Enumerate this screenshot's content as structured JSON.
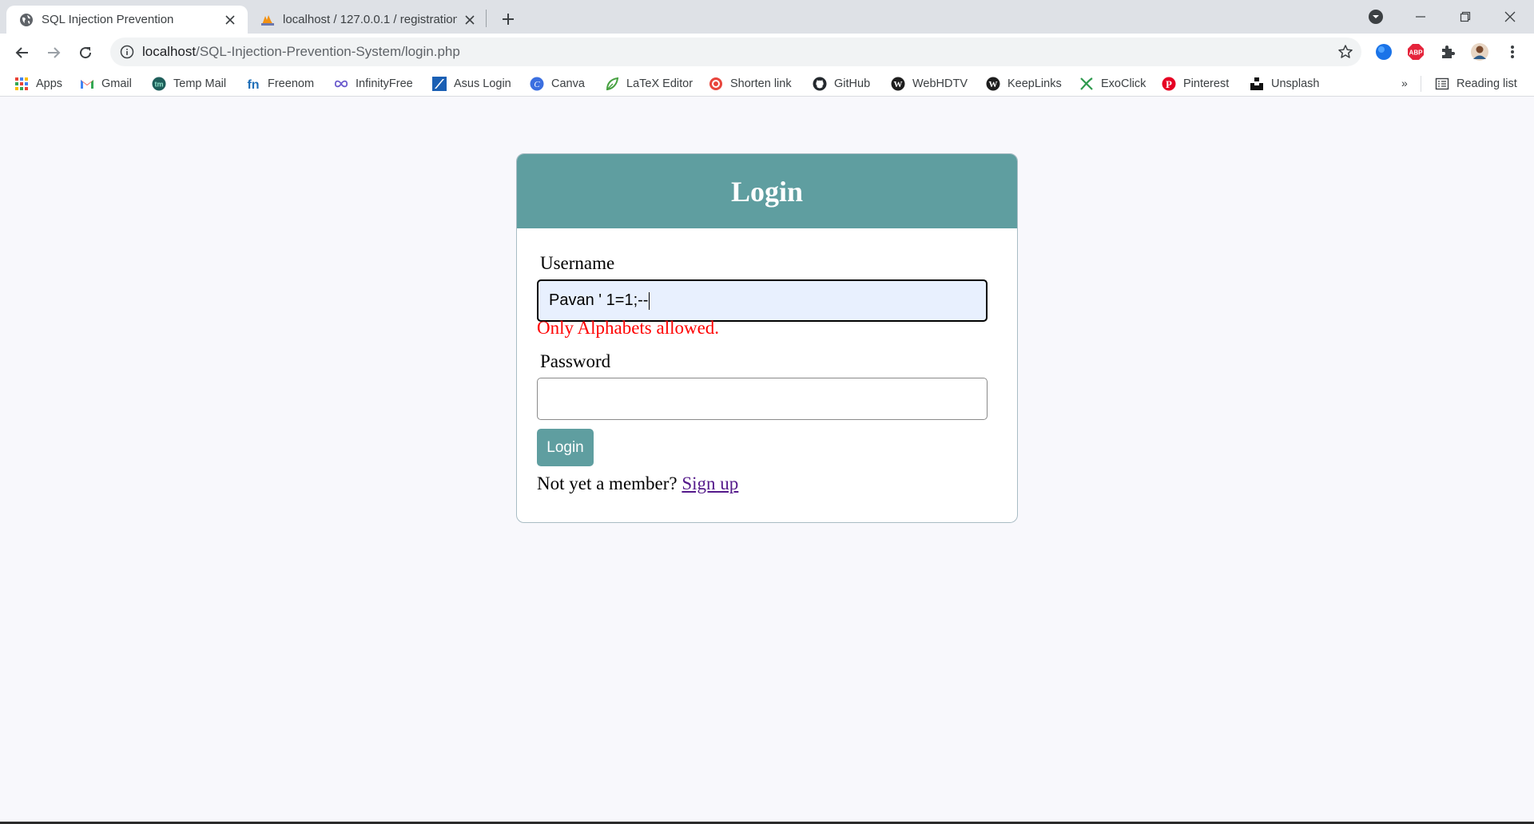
{
  "browser": {
    "tabs": [
      {
        "title": "SQL Injection Prevention",
        "active": true
      },
      {
        "title": "localhost / 127.0.0.1 / registration",
        "active": false
      }
    ],
    "address": {
      "host": "localhost",
      "path": "/SQL-Injection-Prevention-System/login.php"
    },
    "bookmarks": [
      {
        "label": "Apps",
        "icon": "apps-grid-icon"
      },
      {
        "label": "Gmail",
        "icon": "gmail-icon"
      },
      {
        "label": "Temp Mail",
        "icon": "temp-mail-icon"
      },
      {
        "label": "Freenom",
        "icon": "freenom-icon"
      },
      {
        "label": "InfinityFree",
        "icon": "infinity-icon"
      },
      {
        "label": "Asus Login",
        "icon": "asus-icon"
      },
      {
        "label": "Canva",
        "icon": "canva-icon"
      },
      {
        "label": "LaTeX Editor",
        "icon": "leaf-icon"
      },
      {
        "label": "Shorten link",
        "icon": "target-icon"
      },
      {
        "label": "GitHub",
        "icon": "github-icon"
      },
      {
        "label": "WebHDTV",
        "icon": "wordpress-icon"
      },
      {
        "label": "KeepLinks",
        "icon": "wordpress-icon"
      },
      {
        "label": "ExoClick",
        "icon": "exoclick-icon"
      },
      {
        "label": "Pinterest",
        "icon": "pinterest-icon"
      },
      {
        "label": "Unsplash",
        "icon": "unsplash-icon"
      }
    ],
    "more_bookmarks": "»",
    "reading_list": "Reading list"
  },
  "login": {
    "title": "Login",
    "username_label": "Username",
    "username_value": "Pavan ' 1=1;--",
    "error": "Only Alphabets allowed.",
    "password_label": "Password",
    "password_value": "",
    "button": "Login",
    "footer_text": "Not yet a member?",
    "signup_link": "Sign up"
  },
  "colors": {
    "header": "#5f9ea0",
    "error": "#ff0000",
    "link": "#551a8b"
  }
}
